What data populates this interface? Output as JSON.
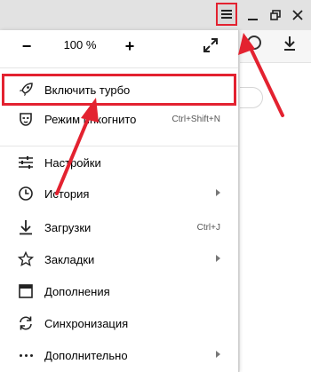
{
  "zoom": {
    "minus": "−",
    "value": "100 %",
    "plus": "+"
  },
  "menu": {
    "items": [
      {
        "label": "Включить турбо",
        "icon": "rocket-icon"
      },
      {
        "label": "Режим инкогнито",
        "shortcut": "Ctrl+Shift+N",
        "icon": "incognito-mask-icon"
      },
      {
        "label": "Настройки",
        "icon": "settings-sliders-icon"
      },
      {
        "label": "История",
        "icon": "history-clock-icon",
        "submenu": true
      },
      {
        "label": "Загрузки",
        "shortcut": "Ctrl+J",
        "icon": "download-icon"
      },
      {
        "label": "Закладки",
        "icon": "star-icon",
        "submenu": true
      },
      {
        "label": "Дополнения",
        "icon": "extensions-icon"
      },
      {
        "label": "Синхронизация",
        "icon": "sync-icon"
      },
      {
        "label": "Дополнительно",
        "icon": "more-dots-icon",
        "submenu": true
      }
    ]
  },
  "colors": {
    "highlight": "#e32230",
    "titlebar": "#e2e2e2",
    "menu_bg": "#ffffff"
  }
}
